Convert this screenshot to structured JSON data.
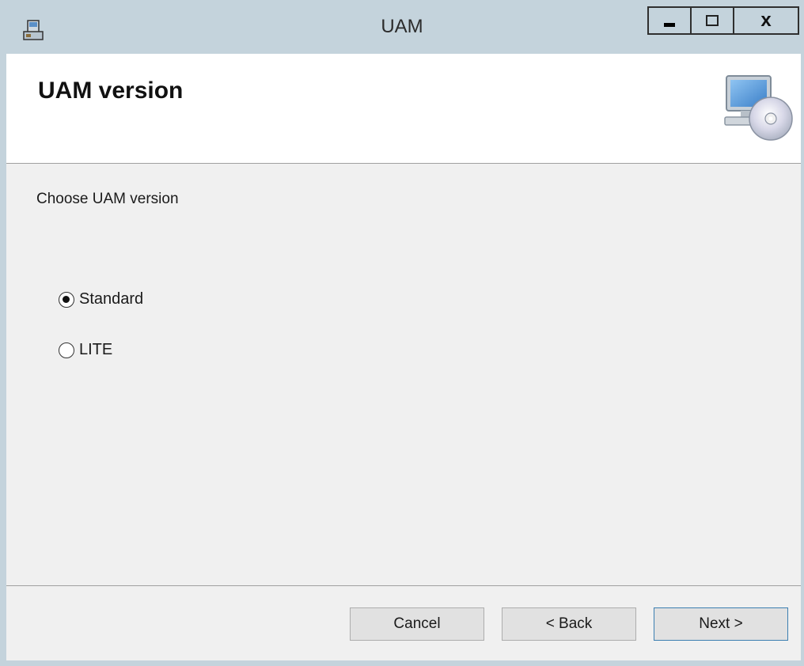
{
  "window": {
    "title": "UAM",
    "controls": {
      "minimize": "minimize",
      "maximize": "maximize",
      "close": "x"
    }
  },
  "header": {
    "title": "UAM version",
    "icon": "computer-cd-icon"
  },
  "content": {
    "instruction": "Choose UAM version",
    "options": [
      {
        "label": "Standard",
        "checked": true
      },
      {
        "label": "LITE",
        "checked": false
      }
    ]
  },
  "footer": {
    "cancel_label": "Cancel",
    "back_label": "< Back",
    "next_label": "Next >"
  },
  "colors": {
    "titlebar": "#c4d3dc",
    "header_bg": "#ffffff",
    "content_bg": "#f0f0f0",
    "button_bg": "#e1e1e1",
    "default_button_border": "#3c7fb1"
  }
}
